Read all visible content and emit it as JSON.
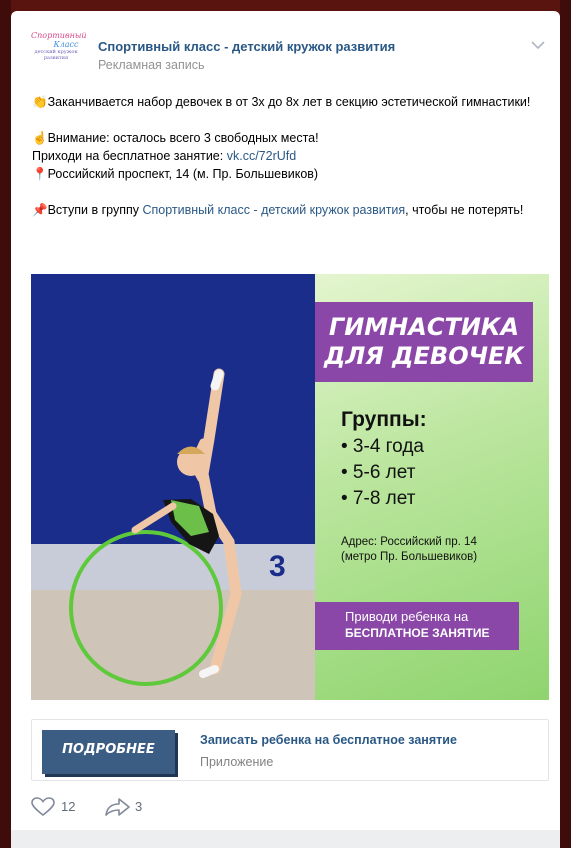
{
  "post": {
    "group_name": "Спортивный класс - детский кружок развития",
    "ad_label": "Рекламная запись",
    "avatar_text": {
      "line1": "Спортивный",
      "line2": "Класс",
      "line3": "детский кружок развития"
    },
    "text": {
      "p1_emoji": "👏",
      "p1": "Заканчивается набор девочек в от 3х до 8х лет в секцию эстетической гимнастики!",
      "p2_emoji": "☝",
      "p2": "Внимание: осталось всего 3 свободных места!",
      "p3_prefix": "Приходи на бесплатное занятие: ",
      "p3_link": "vk.cc/72rUfd",
      "p4_emoji": "📍",
      "p4": "Российский проспект, 14 (м. Пр. Большевиков)",
      "p5_emoji": "📌",
      "p5_prefix": "Вступи в группу ",
      "p5_link": "Спортивный класс - детский кружок развития",
      "p5_suffix": ", чтобы не потерять!"
    }
  },
  "ad_image": {
    "title_line1": "ГИМНАСТИКА",
    "title_line2": "ДЛЯ ДЕВОЧЕК",
    "groups_title": "Группы:",
    "groups": [
      "• 3-4 года",
      "• 5-6 лет",
      "• 7-8 лет"
    ],
    "address_line1": "Адрес: Российский пр. 14",
    "address_line2": "(метро Пр. Большевиков)",
    "cta_line1": "Приводи ребенка на",
    "cta_line2": "БЕСПЛАТНОЕ ЗАНЯТИЕ",
    "scoreboard_number": "3"
  },
  "app": {
    "button_label": "ПОДРОБНЕЕ",
    "title": "Записать ребенка на бесплатное занятие",
    "subtitle": "Приложение"
  },
  "actions": {
    "likes": "12",
    "shares": "3"
  },
  "colors": {
    "link": "#2a5885",
    "accent_purple": "#8a47a8",
    "button_blue": "#3c5d83",
    "promo_green": "#8fd46f"
  }
}
